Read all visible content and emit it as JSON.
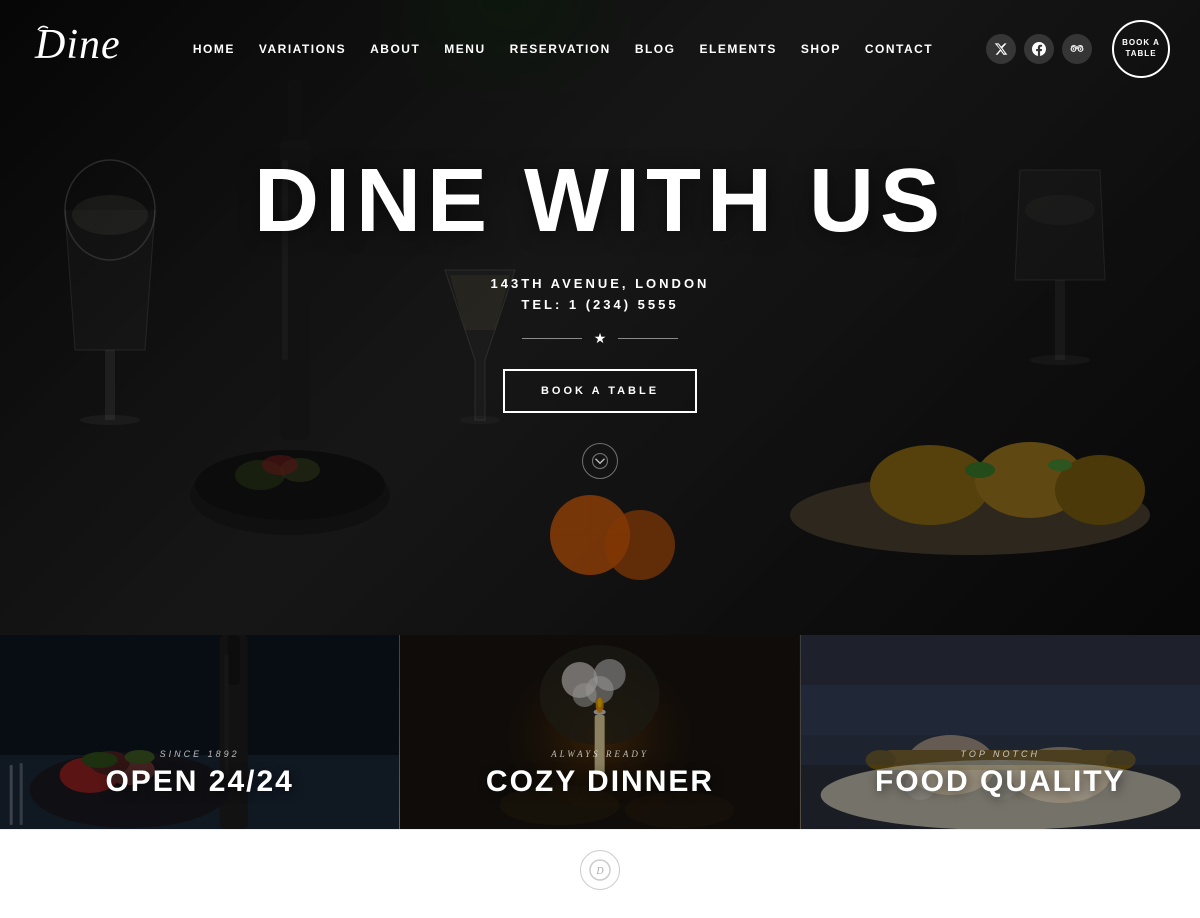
{
  "site": {
    "name": "Dine",
    "logo_text": "Dine"
  },
  "navbar": {
    "links": [
      {
        "id": "home",
        "label": "HOME"
      },
      {
        "id": "variations",
        "label": "VARIATIONS"
      },
      {
        "id": "about",
        "label": "ABOUT"
      },
      {
        "id": "menu",
        "label": "MENU"
      },
      {
        "id": "reservation",
        "label": "RESERVATION"
      },
      {
        "id": "blog",
        "label": "BLOG"
      },
      {
        "id": "elements",
        "label": "ELEMENTS"
      },
      {
        "id": "shop",
        "label": "SHOP"
      },
      {
        "id": "contact",
        "label": "CONTACT"
      }
    ],
    "social": [
      {
        "id": "twitter",
        "icon": "𝕏",
        "label": "Twitter"
      },
      {
        "id": "facebook",
        "icon": "f",
        "label": "Facebook"
      },
      {
        "id": "tripadvisor",
        "icon": "✈",
        "label": "TripAdvisor"
      }
    ],
    "book_btn": "BOOK A\nTABLE"
  },
  "hero": {
    "title": "DINE WITH US",
    "address": "143TH AVENUE, LONDON",
    "phone": "TEL: 1 (234) 5555",
    "book_btn_label": "BOOK A TABLE",
    "scroll_icon": "⌄"
  },
  "cards": [
    {
      "id": "card-1",
      "subtitle": "SINCE 1892",
      "title": "OPEN 24/24"
    },
    {
      "id": "card-2",
      "subtitle": "ALWAYS READY",
      "title": "COZY DINNER"
    },
    {
      "id": "card-3",
      "subtitle": "TOP NOTCH",
      "title": "FOOD QUALITY"
    }
  ],
  "colors": {
    "hero_bg": "#1a1a1a",
    "nav_text": "#ffffff",
    "accent": "#ffffff",
    "card_title": "#ffffff"
  }
}
